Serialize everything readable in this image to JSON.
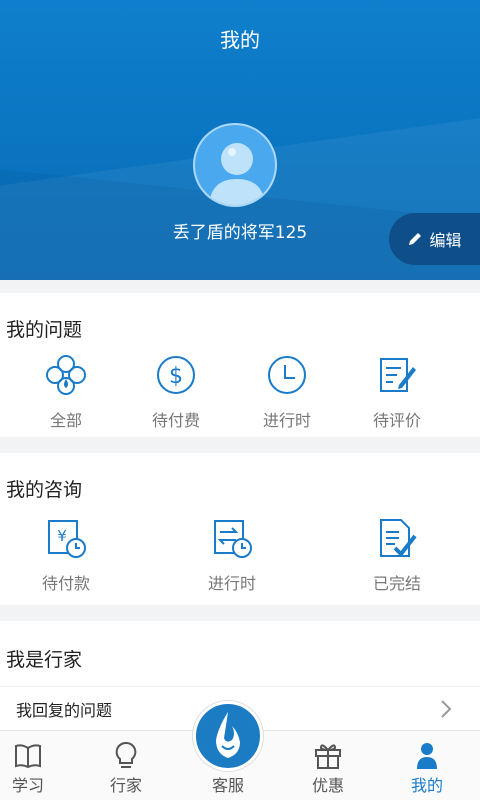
{
  "header": {
    "title": "我的",
    "username": "丢了盾的将军125",
    "edit_label": "编辑"
  },
  "my_questions": {
    "title": "我的问题",
    "items": [
      {
        "label": "全部",
        "icon": "clover-icon"
      },
      {
        "label": "待付费",
        "icon": "dollar-circle-icon"
      },
      {
        "label": "进行时",
        "icon": "clock-icon"
      },
      {
        "label": "待评价",
        "icon": "edit-note-icon"
      }
    ]
  },
  "my_consultations": {
    "title": "我的咨询",
    "items": [
      {
        "label": "待付款",
        "icon": "yuan-clock-icon"
      },
      {
        "label": "进行时",
        "icon": "exchange-clock-icon"
      },
      {
        "label": "已完结",
        "icon": "document-check-icon"
      }
    ]
  },
  "expert": {
    "title": "我是行家",
    "row_label": "我回复的问题"
  },
  "tabbar": {
    "items": [
      {
        "label": "学习",
        "icon": "book-icon"
      },
      {
        "label": "行家",
        "icon": "lightbulb-icon"
      },
      {
        "label": "客服",
        "icon": "horse-logo-icon"
      },
      {
        "label": "优惠",
        "icon": "gift-icon"
      },
      {
        "label": "我的",
        "icon": "person-icon"
      }
    ],
    "active": "我的"
  },
  "colors": {
    "primary": "#1a7cc9",
    "header": "#0a74c0",
    "edit_bg": "#0e4f8a"
  }
}
